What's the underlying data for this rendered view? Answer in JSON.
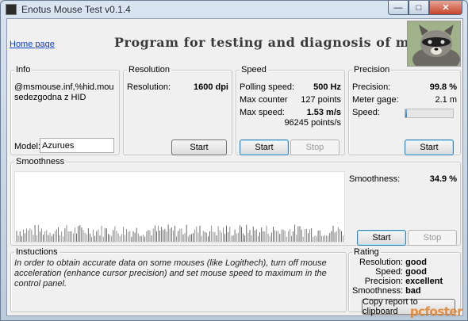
{
  "window": {
    "title": "Enotus Mouse Test v0.1.4",
    "buttons": {
      "minimize": "—",
      "maximize": "□",
      "close": "✕"
    }
  },
  "header": {
    "home_link": "Home page",
    "program_title": "Program for testing and diagnosis of mice"
  },
  "info": {
    "legend": "Info",
    "device_text": "@msmouse.inf,%hid.mousedezgodna z HID",
    "model_label": "Model:",
    "model_value": "Azurues"
  },
  "resolution": {
    "legend": "Resolution",
    "label": "Resolution:",
    "value": "1600 dpi",
    "start_label": "Start"
  },
  "speed": {
    "legend": "Speed",
    "polling_label": "Polling speed:",
    "polling_value": "500 Hz",
    "max_counter_label": "Max counter",
    "max_counter_value": "127 points",
    "max_speed_label": "Max  speed:",
    "max_speed_value": "1.53 m/s",
    "max_speed_points": "96245 points/s",
    "start_label": "Start",
    "stop_label": "Stop"
  },
  "precision": {
    "legend": "Precision",
    "precision_label": "Precision:",
    "precision_value": "99.8 %",
    "meter_gage_label": "Meter gage:",
    "meter_gage_value": "2.1 m",
    "speed_label": "Speed:",
    "speed_level": 0.04,
    "start_label": "Start"
  },
  "smoothness": {
    "legend": "Smoothness",
    "label": "Smoothness:",
    "value": "34.9 %",
    "start_label": "Start",
    "stop_label": "Stop"
  },
  "instructions": {
    "legend": "Instuctions",
    "text": "In order to obtain accurate data on some mouses (like Logithech), turn off mouse acceleration (enhance cursor precision) and set mouse speed to maximum in the control panel."
  },
  "rating": {
    "legend": "Rating",
    "rows": [
      {
        "label": "Resolution:",
        "value": "good"
      },
      {
        "label": "Speed:",
        "value": "good"
      },
      {
        "label": "Precision:",
        "value": "excellent"
      },
      {
        "label": "Smoothness:",
        "value": "bad"
      }
    ],
    "copy_button": "Copy report to clipboard"
  },
  "watermark": "pcfoster"
}
